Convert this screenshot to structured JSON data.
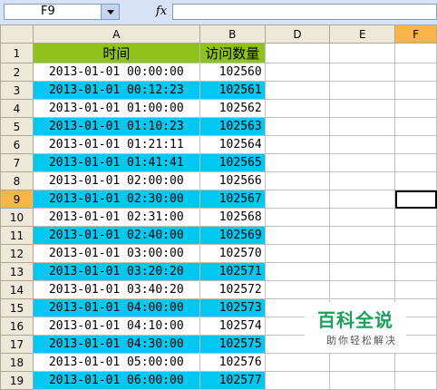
{
  "formula_bar": {
    "name_box": "F9",
    "fx_label": "fx",
    "formula": ""
  },
  "columns": [
    "A",
    "B",
    "D",
    "E",
    "F"
  ],
  "header_row": {
    "row_label": "1",
    "col_a": "时间",
    "col_b": "访问数量"
  },
  "rows": [
    {
      "row": "2",
      "time": "2013-01-01 00:00:00",
      "count": "102560",
      "highlight": false
    },
    {
      "row": "3",
      "time": "2013-01-01 00:12:23",
      "count": "102561",
      "highlight": true
    },
    {
      "row": "4",
      "time": "2013-01-01 01:00:00",
      "count": "102562",
      "highlight": false
    },
    {
      "row": "5",
      "time": "2013-01-01 01:10:23",
      "count": "102563",
      "highlight": true
    },
    {
      "row": "6",
      "time": "2013-01-01 01:21:11",
      "count": "102564",
      "highlight": false
    },
    {
      "row": "7",
      "time": "2013-01-01 01:41:41",
      "count": "102565",
      "highlight": true
    },
    {
      "row": "8",
      "time": "2013-01-01 02:00:00",
      "count": "102566",
      "highlight": false
    },
    {
      "row": "9",
      "time": "2013-01-01 02:30:00",
      "count": "102567",
      "highlight": true
    },
    {
      "row": "10",
      "time": "2013-01-01 02:31:00",
      "count": "102568",
      "highlight": false
    },
    {
      "row": "11",
      "time": "2013-01-01 02:40:00",
      "count": "102569",
      "highlight": true
    },
    {
      "row": "12",
      "time": "2013-01-01 03:00:00",
      "count": "102570",
      "highlight": false
    },
    {
      "row": "13",
      "time": "2013-01-01 03:20:20",
      "count": "102571",
      "highlight": true
    },
    {
      "row": "14",
      "time": "2013-01-01 03:40:20",
      "count": "102572",
      "highlight": false
    },
    {
      "row": "15",
      "time": "2013-01-01 04:00:00",
      "count": "102573",
      "highlight": true
    },
    {
      "row": "16",
      "time": "2013-01-01 04:10:00",
      "count": "102574",
      "highlight": false
    },
    {
      "row": "17",
      "time": "2013-01-01 04:30:00",
      "count": "102575",
      "highlight": true
    },
    {
      "row": "18",
      "time": "2013-01-01 05:00:00",
      "count": "102576",
      "highlight": false
    },
    {
      "row": "19",
      "time": "2013-01-01 06:00:00",
      "count": "102577",
      "highlight": true
    }
  ],
  "active_cell": "F9",
  "colors": {
    "header_fill": "#8fc21b",
    "highlight_fill": "#00c8f0",
    "active_header": "#f9b44a"
  },
  "watermark": {
    "logo": "百科全说",
    "subtitle": "助你轻松解决"
  }
}
